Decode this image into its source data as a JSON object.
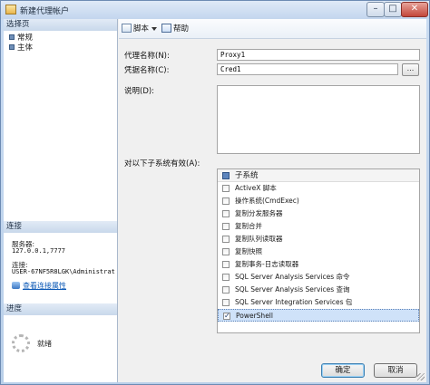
{
  "window": {
    "title": "新建代理帐户",
    "controls": {
      "minimize": "–",
      "maximize": "□",
      "close": "✕"
    }
  },
  "sidebar": {
    "select_page_header": "选择页",
    "pages": [
      {
        "label": "常规",
        "icon": "page-icon"
      },
      {
        "label": "主体",
        "icon": "page-icon"
      }
    ],
    "connection_header": "连接",
    "server_label": "服务器:",
    "server_value": "127.0.0.1,7777",
    "connection_label": "连接:",
    "connection_value": "USER-67NF5R8LGK\\Administrat",
    "view_properties_link": "查看连接属性",
    "progress_header": "进度",
    "progress_status": "就绪"
  },
  "toolbar": {
    "script_label": "脚本",
    "help_label": "帮助"
  },
  "form": {
    "proxy_name_label": "代理名称(N):",
    "proxy_name_value": "Proxy1",
    "credential_label": "凭据名称(C):",
    "credential_value": "Cred1",
    "browse_label": "...",
    "description_label": "说明(D):",
    "description_value": "",
    "subsystems_label": "对以下子系统有效(A):"
  },
  "subsystems": {
    "header": "子系统",
    "items": [
      {
        "label": "ActiveX 脚本",
        "checked": false
      },
      {
        "label": "操作系统(CmdExec)",
        "checked": false
      },
      {
        "label": "复制分发服务器",
        "checked": false
      },
      {
        "label": "复制合并",
        "checked": false
      },
      {
        "label": "复制队列读取器",
        "checked": false
      },
      {
        "label": "复制快照",
        "checked": false
      },
      {
        "label": "复制事务-日志读取器",
        "checked": false
      },
      {
        "label": "SQL Server Analysis Services 命令",
        "checked": false
      },
      {
        "label": "SQL Server Analysis Services 查询",
        "checked": false
      },
      {
        "label": "SQL Server Integration Services 包",
        "checked": false
      },
      {
        "label": "PowerShell",
        "checked": true,
        "selected": true
      }
    ]
  },
  "footer": {
    "ok_label": "确定",
    "cancel_label": "取消"
  },
  "colors": {
    "title_bar": "#c3d6ee",
    "selected_row": "#cfe2f9",
    "link": "#0b58b6",
    "close_button": "#c3463a"
  }
}
